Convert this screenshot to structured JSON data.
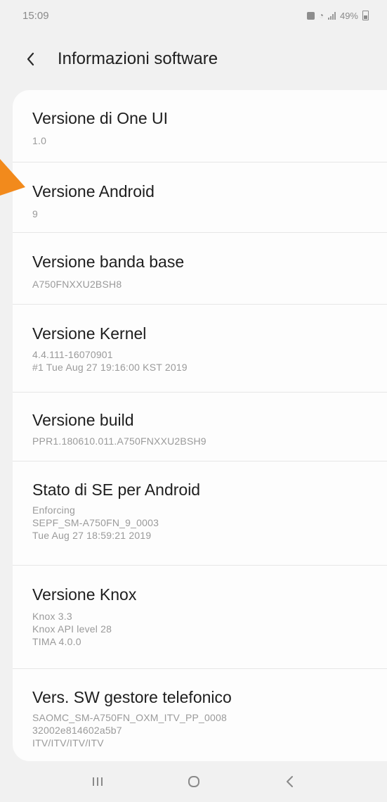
{
  "status_bar": {
    "time": "15:09",
    "battery_text": "49%"
  },
  "header": {
    "title": "Informazioni software"
  },
  "items": [
    {
      "title": "Versione di One UI",
      "lines": [
        "1.0"
      ]
    },
    {
      "title": "Versione Android",
      "lines": [
        "9"
      ]
    },
    {
      "title": "Versione banda base",
      "lines": [
        "A750FNXXU2BSH8"
      ]
    },
    {
      "title": "Versione Kernel",
      "lines": [
        "4.4.111-16070901",
        "#1 Tue Aug 27 19:16:00 KST 2019"
      ]
    },
    {
      "title": "Versione build",
      "lines": [
        "PPR1.180610.011.A750FNXXU2BSH9"
      ]
    },
    {
      "title": "Stato di SE per Android",
      "lines": [
        "Enforcing",
        "SEPF_SM-A750FN_9_0003",
        "Tue Aug 27 18:59:21 2019"
      ]
    },
    {
      "title": "Versione Knox",
      "lines": [
        "Knox 3.3",
        "Knox API level 28",
        "TIMA 4.0.0"
      ]
    },
    {
      "title": "Vers. SW gestore telefonico",
      "lines": [
        "SAOMC_SM-A750FN_OXM_ITV_PP_0008",
        "32002e814602a5b7",
        "ITV/ITV/ITV/ITV"
      ]
    }
  ],
  "icons": {
    "back": "back-chevron-icon",
    "arrow": "orange-arrow-pointer",
    "recents": "recents-icon",
    "home": "home-icon",
    "nav_back": "back-icon"
  },
  "colors": {
    "accent_arrow": "#f28a1c",
    "card_bg": "#fdfdfd",
    "page_bg": "#f1f1f1"
  }
}
